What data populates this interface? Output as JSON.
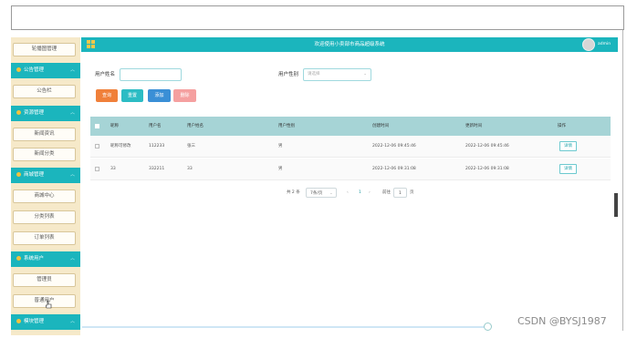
{
  "header": {
    "title": "欢迎使用小卖部市商品超级系统",
    "username": "admin"
  },
  "sidebar": {
    "items": [
      {
        "type": "item",
        "label": "轮播图管理"
      },
      {
        "type": "group",
        "label": "公告管理"
      },
      {
        "type": "item",
        "label": "公告栏"
      },
      {
        "type": "group",
        "label": "资源管理"
      },
      {
        "type": "item",
        "label": "新闻资讯"
      },
      {
        "type": "item",
        "label": "新闻分类"
      },
      {
        "type": "group",
        "label": "商城管理"
      },
      {
        "type": "item",
        "label": "商城中心"
      },
      {
        "type": "item",
        "label": "分类列表"
      },
      {
        "type": "item",
        "label": "订单列表"
      },
      {
        "type": "group",
        "label": "系统用户"
      },
      {
        "type": "item",
        "label": "管理员"
      },
      {
        "type": "item",
        "label": "普通用户"
      },
      {
        "type": "group",
        "label": "模块管理"
      }
    ]
  },
  "search": {
    "name_label": "用户姓名",
    "name_value": "",
    "gender_label": "用户性别",
    "gender_placeholder": "请选择"
  },
  "actions": {
    "search": "查询",
    "reset": "重置",
    "add": "添加",
    "delete": "删除"
  },
  "colors": {
    "teal": "#1bb5bd",
    "search_btn": "#f0803a",
    "reset_btn": "#2cbcc4",
    "add_btn": "#3a8fd6",
    "delete_btn": "#f5a0a0"
  },
  "table": {
    "columns": [
      "昵称",
      "用户名",
      "用户姓名",
      "用户性别",
      "创建时间",
      "更新时间",
      "操作"
    ],
    "rows": [
      {
        "nickname": "昵称可修改",
        "username": "112233",
        "realname": "张三",
        "gender": "男",
        "created": "2022-12-06 09:45:46",
        "updated": "2022-12-06 09:45:46",
        "op": "详情"
      },
      {
        "nickname": "33",
        "username": "332211",
        "realname": "33",
        "gender": "男",
        "created": "2022-12-06 09:31:08",
        "updated": "2022-12-06 09:31:08",
        "op": "详情"
      }
    ]
  },
  "pager": {
    "total": "共 2 条",
    "page_size": "7条/页",
    "prev": "‹",
    "current": "1",
    "next": "›",
    "goto": "前往",
    "goto_value": "1",
    "page_unit": "页"
  },
  "watermark": "CSDN @BYSJ1987"
}
